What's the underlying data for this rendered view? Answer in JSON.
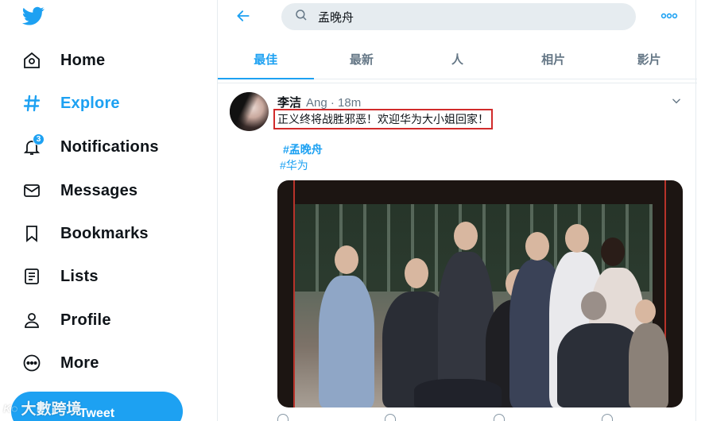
{
  "sidebar": {
    "logo_icon": "twitter-bird-icon",
    "items": [
      {
        "label": "Home",
        "icon": "home-icon"
      },
      {
        "label": "Explore",
        "icon": "hashtag-icon",
        "active": true
      },
      {
        "label": "Notifications",
        "icon": "bell-icon",
        "badge": "3"
      },
      {
        "label": "Messages",
        "icon": "envelope-icon"
      },
      {
        "label": "Bookmarks",
        "icon": "bookmark-icon"
      },
      {
        "label": "Lists",
        "icon": "list-icon"
      },
      {
        "label": "Profile",
        "icon": "person-icon"
      },
      {
        "label": "More",
        "icon": "more-circle-icon"
      }
    ],
    "tweet_button": "Tweet",
    "watermark": "大數跨境"
  },
  "topbar": {
    "back_icon": "arrow-left-icon",
    "search_value": "孟晚舟",
    "more_icon": "more-dots-icon"
  },
  "tabs": [
    "最佳",
    "最新",
    "人",
    "相片",
    "影片"
  ],
  "active_tab": 0,
  "tweet": {
    "author": "李洁",
    "handle": "Ang · 18m",
    "text": "正义终将战胜邪恶！欢迎华为大小姐回家！",
    "hashtags": [
      "#孟晚舟",
      "#华为"
    ]
  },
  "colors": {
    "accent": "#1da1f2",
    "highlight_box": "#d12b2b",
    "text_primary": "#0f1419",
    "text_secondary": "#657786"
  }
}
